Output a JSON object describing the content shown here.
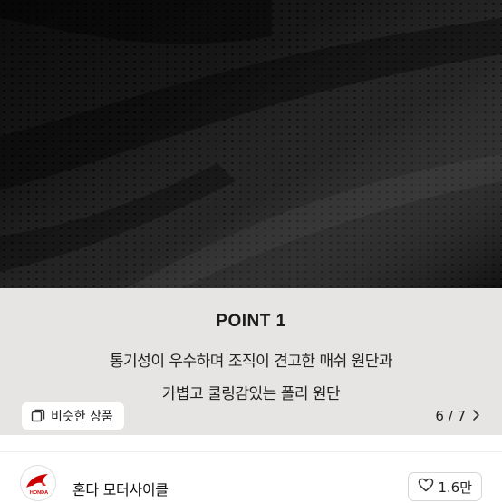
{
  "product_image": {
    "alt": ""
  },
  "info": {
    "point_title": "POINT 1",
    "description_line1": "통기성이 우수하며 조직이 견고한 매쉬 원단과",
    "description_line2": "가볍고 쿨링감있는 폴리 원단"
  },
  "similar_button": {
    "label": "비슷한 상품",
    "icon": "similar-products-icon"
  },
  "pager": {
    "text": "6 / 7",
    "icon": "chevron-right-icon"
  },
  "shop": {
    "name": "혼다 모터사이클",
    "logo_text": "HONDA",
    "like_label": "1.6만",
    "like_icon": "heart-icon",
    "brand_color": "#cc0000"
  }
}
